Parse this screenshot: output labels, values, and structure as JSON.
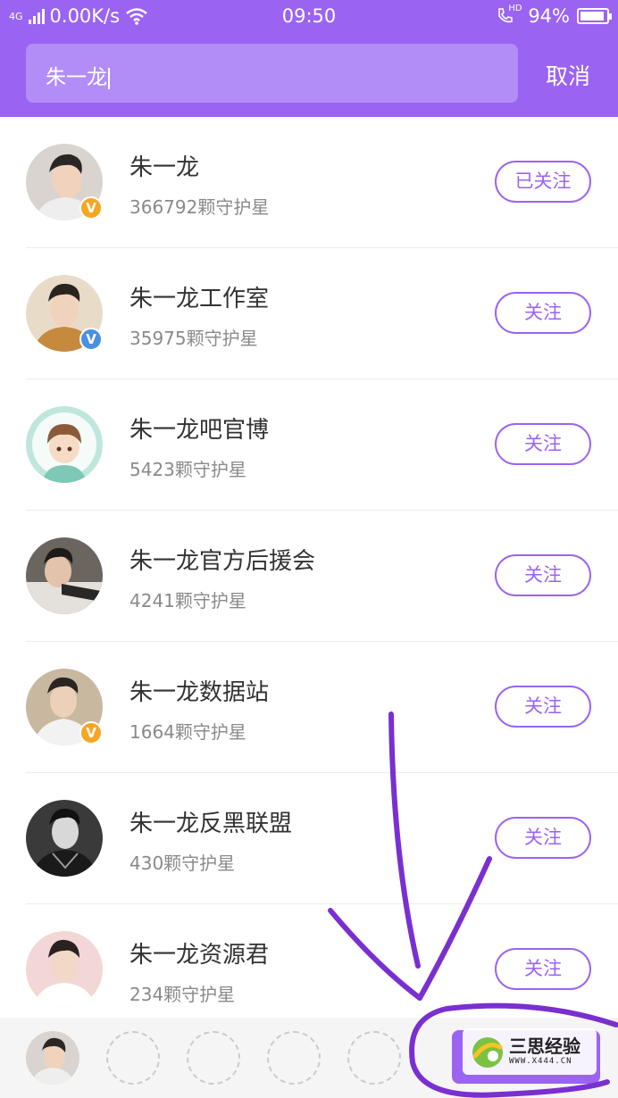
{
  "status_bar": {
    "network": "4G",
    "speed": "0.00K/s",
    "time": "09:50",
    "hd_label": "HD",
    "battery": "94%",
    "battery_level": 0.94
  },
  "search": {
    "value": "朱一龙",
    "cancel_label": "取消"
  },
  "results": [
    {
      "name": "朱一龙",
      "count": "366792颗守护星",
      "button": "已关注",
      "verified": "V",
      "verified_color": "#f5a623"
    },
    {
      "name": "朱一龙工作室",
      "count": "35975颗守护星",
      "button": "关注",
      "verified": "V",
      "verified_color": "#4a90e2"
    },
    {
      "name": "朱一龙吧官博",
      "count": "5423颗守护星",
      "button": "关注"
    },
    {
      "name": "朱一龙官方后援会",
      "count": "4241颗守护星",
      "button": "关注"
    },
    {
      "name": "朱一龙数据站",
      "count": "1664颗守护星",
      "button": "关注",
      "verified": "V",
      "verified_color": "#f5a623"
    },
    {
      "name": "朱一龙反黑联盟",
      "count": "430颗守护星",
      "button": "关注"
    },
    {
      "name": "朱一龙资源君",
      "count": "234颗守护星",
      "button": "关注"
    }
  ],
  "watermark": {
    "title": "三思经验",
    "url": "WWW.X444.CN"
  },
  "colors": {
    "accent": "#9b63f2",
    "search_bg": "#b28df7",
    "annotation": "#7a2fd0"
  }
}
